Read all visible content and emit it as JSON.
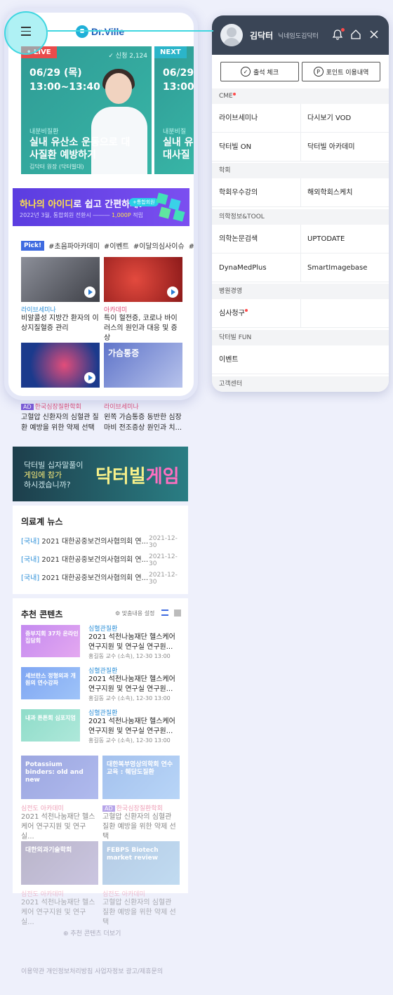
{
  "header": {
    "logo_text": "Dr.Ville"
  },
  "live_card": {
    "badge": "• LIVE",
    "count": "✓ 신청 2,124",
    "date": "06/29 (목)",
    "time": "13:00~13:40",
    "category": "내분비질환",
    "title": "실내 유산소 운동으로 대사질환 예방하기",
    "author": "김닥터 원장 (닥터빌대)"
  },
  "next_card": {
    "badge": "NEXT",
    "date": "06/29",
    "time": "13:00",
    "category": "내분비질",
    "title_line1": "실내 유",
    "title_line2": "대사질"
  },
  "banner": {
    "highlight": "하나의 아이디",
    "rest": "로 쉽고 간편하게!",
    "tag": "+통합회원",
    "sub_prefix": "2022년 3월, 통합회원 전환시 ―――",
    "sub_amount": "1,000P",
    "sub_suffix": "적립"
  },
  "pick": {
    "label": "Pick!",
    "tags": [
      "#초음파아카데미",
      "#이벤트",
      "#이달의심사이슈",
      "#보"
    ]
  },
  "thumbs": [
    {
      "category": "라이브세미나",
      "text": "비알콜성 지방간 환자의 이상지질혈증 관리"
    },
    {
      "category": "아카데미",
      "text": "특이 혈전증, 코로나 바이러스의 원인과 대응 및 증상"
    },
    {
      "category": "",
      "text": ""
    },
    {
      "category": "",
      "text": "가슴통증"
    }
  ],
  "under_phone": [
    {
      "ad": "AD",
      "category": "한국심장질환학회",
      "text": "고혈압 신환자의 심혈관 질환 예방을 위한 약제 선택"
    },
    {
      "ad": "",
      "category": "라이브세미나",
      "text": "왼쪽 가슴통증 동반한 심장마비 전조증상 원인과 치..."
    }
  ],
  "game": {
    "line1": "닥터빌 십자말풀이",
    "line2": "게임에 참가",
    "line3": "하시겠습니까?",
    "logo_a": "닥터빌",
    "logo_b": "게임"
  },
  "news": {
    "title": "의료계 뉴스",
    "rows": [
      {
        "tag": "[국내]",
        "text": "2021 대한공중보건의사협의회 연...",
        "date": "2021-12-30"
      },
      {
        "tag": "[국내]",
        "text": "2021 대한공중보건의사협의회 연...",
        "date": "2021-12-30"
      },
      {
        "tag": "[국내]",
        "text": "2021 대한공중보건의사협의회 연...",
        "date": "2021-12-30"
      }
    ]
  },
  "recommend": {
    "title": "추천 콘텐츠",
    "settings": "⚙ 맞춤내용 설정",
    "items": [
      {
        "thumb": "중부지회 37차 온라인 집담회",
        "category": "심혈관질환",
        "text": "2021 석천나눔재단 헬스케어 연구지원 및 연구실 연구원...",
        "sub": "홍길동 교수 (소속), 12-30 13:00"
      },
      {
        "thumb": "세브란스 정형외과 개원의 연수강좌",
        "category": "심혈관질환",
        "text": "2021 석천나눔재단 헬스케어 연구지원 및 연구실 연구원...",
        "sub": "홍길동 교수 (소속), 12-30 13:00"
      },
      {
        "thumb": "내과 튼튼회 심포지엄",
        "category": "심혈관질환",
        "text": "2021 석천나눔재단 헬스케어 연구지원 및 연구실 연구원...",
        "sub": "홍길동 교수 (소속), 12-30 13:00"
      }
    ],
    "grid": [
      {
        "thumb": "Potassium binders: old and new",
        "category": "심전도 아카데미",
        "text": "2021 석천나눔재단 헬스케어 연구지원 및 연구실...",
        "ad": ""
      },
      {
        "thumb": "대한복부영상의학회 연수교육 : 췌담도질환",
        "category": "한국심장질환학회",
        "text": "고혈압 신환자의 심혈관 질환 예방을 위한 약제 선택",
        "ad": "AD"
      },
      {
        "thumb": "대한외과기술학회",
        "category": "심전도 아카데미",
        "text": "2021 석천나눔재단 헬스케어 연구지원 및 연구실...",
        "ad": ""
      },
      {
        "thumb": "FEBPS Biotech market review",
        "category": "심전도 아카데미",
        "text": "고혈압 신환자의 심혈관 질환 예방을 위한 약제 선택",
        "ad": ""
      }
    ],
    "more": "⊕ 추천 콘텐츠 더보기"
  },
  "footer": {
    "text": "이용약관 개인정보처리방침 사업자정보 광고/제휴문의"
  },
  "menu": {
    "user_name": "김닥터",
    "user_id": "닉네임도김닥터",
    "attendance_label": "출석 체크",
    "points_label": "포인트 이용내역",
    "sections": [
      {
        "label": "CME",
        "dot": true,
        "rows": [
          [
            "라이브세미나",
            "다시보기 VOD"
          ],
          [
            "닥터빌 ON",
            "닥터빌 아카데미"
          ]
        ]
      },
      {
        "label": "학회",
        "dot": false,
        "rows": [
          [
            "학회우수강의",
            "해외학회스케치"
          ]
        ]
      },
      {
        "label": "의학정보&TOOL",
        "dot": false,
        "rows": [
          [
            "의학논문검색",
            "UPTODATE"
          ],
          [
            "DynaMedPlus",
            "SmartImagebase"
          ]
        ]
      },
      {
        "label": "병원경영",
        "dot": false,
        "rows": [
          [
            "심사청구",
            ""
          ]
        ]
      },
      {
        "label": "닥터빌 FUN",
        "dot": false,
        "rows": [
          [
            "이벤트",
            ""
          ]
        ]
      },
      {
        "label": "고객센터",
        "dot": false,
        "rows": []
      }
    ]
  },
  "colors": {
    "accent": "#3fd6e0",
    "panel_header": "#3a4556",
    "live_red": "#e94b4b",
    "banner_purple": "#5b3de0"
  }
}
